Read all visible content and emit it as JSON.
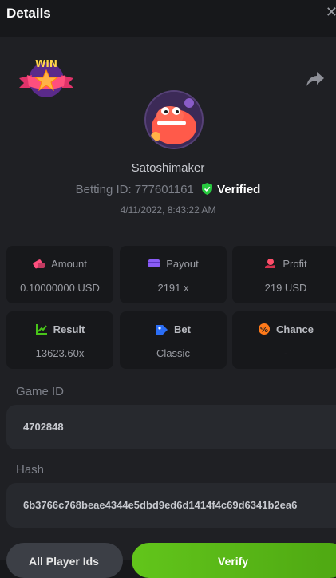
{
  "header": {
    "title": "Details",
    "close_icon": "close-icon"
  },
  "profile": {
    "badge_text": "WIN",
    "username": "Satoshimaker",
    "betting_id_label": "Betting ID:",
    "betting_id": "777601161",
    "verified_label": "Verified",
    "date": "4/11/2022, 8:43:22 AM"
  },
  "stats": {
    "amount": {
      "label": "Amount",
      "value": "0.10000000 USD",
      "icon": "amount-icon"
    },
    "payout": {
      "label": "Payout",
      "value": "2191 x",
      "icon": "payout-icon"
    },
    "profit": {
      "label": "Profit",
      "value": "219 USD",
      "icon": "profit-icon"
    },
    "result": {
      "label": "Result",
      "value": "13623.60x",
      "icon": "result-icon"
    },
    "bet": {
      "label": "Bet",
      "value": "Classic",
      "icon": "bet-icon"
    },
    "chance": {
      "label": "Chance",
      "value": "-",
      "icon": "chance-icon"
    }
  },
  "game_id": {
    "label": "Game ID",
    "value": "4702848"
  },
  "hash": {
    "label": "Hash",
    "value": "6b3766c768beae4344e5dbd9ed6d1414f4c69d6341b2ea6"
  },
  "buttons": {
    "left_label": "All Player Ids",
    "right_label": "Verify"
  },
  "colors": {
    "background": "#17181b",
    "panel": "#1f2024",
    "card": "#17181b",
    "verified": "#27c93f",
    "primary_button": "#5fc21b",
    "secondary_button": "#3c3f46"
  }
}
